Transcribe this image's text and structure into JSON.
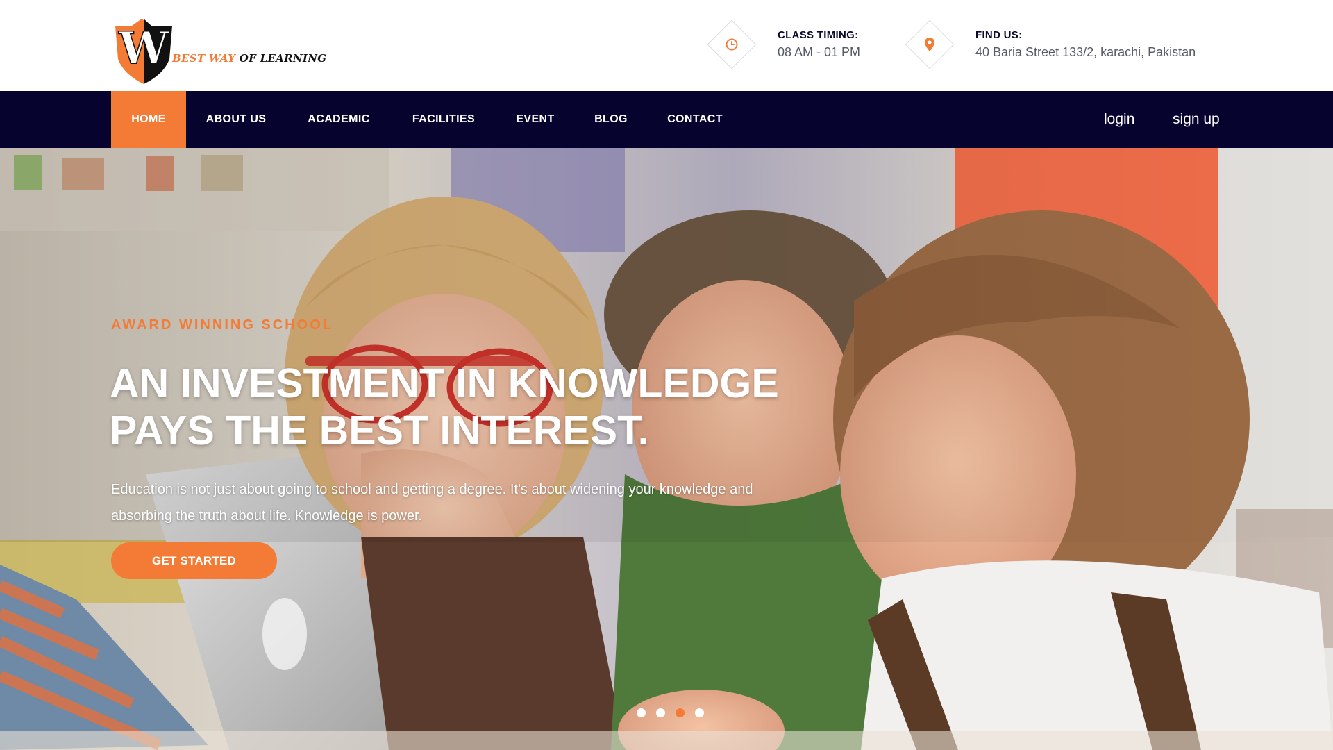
{
  "brand": {
    "logo_letter": "W",
    "name_part1": "BEST WAY",
    "name_part2": "OF LEARNING",
    "accent_color": "#f47b36",
    "nav_color": "#06042e"
  },
  "header": {
    "timing": {
      "icon": "clock-icon",
      "label": "CLASS TIMING:",
      "value": "08 AM - 01 PM"
    },
    "address": {
      "icon": "map-pin-icon",
      "label": "FIND US:",
      "value": "40 Baria Street 133/2, karachi, Pakistan"
    }
  },
  "nav": {
    "items": [
      {
        "label": "HOME",
        "active": true
      },
      {
        "label": "ABOUT US"
      },
      {
        "label": "ACADEMIC"
      },
      {
        "label": "FACILITIES"
      },
      {
        "label": "EVENT"
      },
      {
        "label": "BLOG"
      },
      {
        "label": "CONTACT"
      }
    ],
    "login": "login",
    "signup": "sign up"
  },
  "hero": {
    "eyebrow": "AWARD WINNING SCHOOL",
    "title_line1": "AN INVESTMENT IN KNOWLEDGE",
    "title_line2": "PAYS THE BEST INTEREST.",
    "description": "Education is not just about going to school and getting a degree. It's about widening your knowledge and absorbing the truth about life. Knowledge is power.",
    "cta": "GET STARTED",
    "slides_total": 4,
    "active_slide": 3
  }
}
